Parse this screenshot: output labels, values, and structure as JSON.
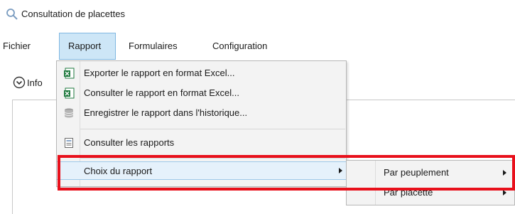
{
  "window": {
    "title": "Consultation de placettes",
    "title_icon": "search-icon"
  },
  "menubar": {
    "items": [
      {
        "label": "Fichier"
      },
      {
        "label": "Rapport",
        "active": true
      },
      {
        "label": "Formulaires"
      },
      {
        "label": "Configuration"
      }
    ]
  },
  "info_section": {
    "label": "Info",
    "icon": "chevron-down-circle-icon"
  },
  "rapport_menu": {
    "items": [
      {
        "label": "Exporter le rapport en format Excel...",
        "icon": "excel-icon"
      },
      {
        "label": "Consulter le rapport en format Excel...",
        "icon": "excel-icon"
      },
      {
        "label": "Enregistrer le rapport dans l'historique...",
        "icon": "database-icon"
      },
      {
        "label": "Consulter les rapports",
        "icon": "report-window-icon"
      },
      {
        "label": "Choix du rapport",
        "has_submenu": true,
        "highlighted": true
      }
    ]
  },
  "choix_submenu": {
    "items": [
      {
        "label": "Par peuplement",
        "has_submenu": true
      },
      {
        "label": "Par placette",
        "has_submenu": true
      }
    ]
  },
  "colors": {
    "menu_active_bg": "#cde6f7",
    "menu_active_border": "#7fb7e1",
    "highlight_border": "#e8101b",
    "excel_green": "#1f7a3f"
  }
}
